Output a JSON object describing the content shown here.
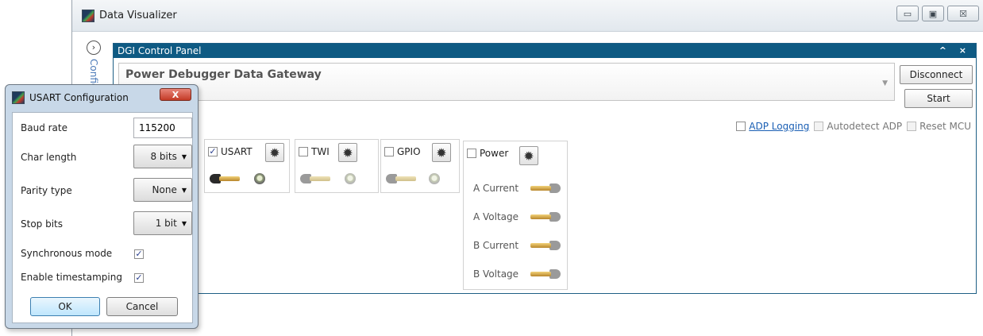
{
  "main_window": {
    "title": "Data Visualizer",
    "controls": {
      "minimize": "▭",
      "maximize": "▣",
      "close": "☒"
    }
  },
  "side_rail": {
    "expand_glyph": "›",
    "label": "Config"
  },
  "dgi_panel": {
    "title": "DGI Control Panel",
    "header_icons": "^ ×",
    "gateway": {
      "name": "Power Debugger Data Gateway",
      "dropdown_glyph": "▼"
    },
    "buttons": {
      "disconnect": "Disconnect",
      "start": "Start"
    },
    "options": {
      "adp_logging": {
        "label": "ADP Logging",
        "checked": false
      },
      "autodetect_adp": {
        "label": "Autodetect ADP",
        "checked": false
      },
      "reset_mcu": {
        "label": "Reset MCU",
        "checked": false
      }
    },
    "interfaces": [
      {
        "label": "USART",
        "checked": true,
        "check_glyph": "✓"
      },
      {
        "label": "TWI",
        "checked": false
      },
      {
        "label": "GPIO",
        "checked": false
      },
      {
        "label": "Power",
        "checked": false
      }
    ],
    "power_channels": [
      "A Current",
      "A Voltage",
      "B Current",
      "B Voltage"
    ],
    "gear_glyph": "✹"
  },
  "usart_dialog": {
    "title": "USART Configuration",
    "close_glyph": "X",
    "fields": {
      "baud_rate": {
        "label": "Baud rate",
        "value": "115200"
      },
      "char_length": {
        "label": "Char length",
        "value": "8 bits"
      },
      "parity_type": {
        "label": "Parity type",
        "value": "None"
      },
      "stop_bits": {
        "label": "Stop bits",
        "value": "1 bit"
      },
      "synchronous_mode": {
        "label": "Synchronous mode",
        "checked": true
      },
      "enable_timestamping": {
        "label": "Enable timestamping",
        "checked": true
      }
    },
    "check_glyph": "✓",
    "caret_glyph": "▼",
    "buttons": {
      "ok": "OK",
      "cancel": "Cancel"
    }
  }
}
